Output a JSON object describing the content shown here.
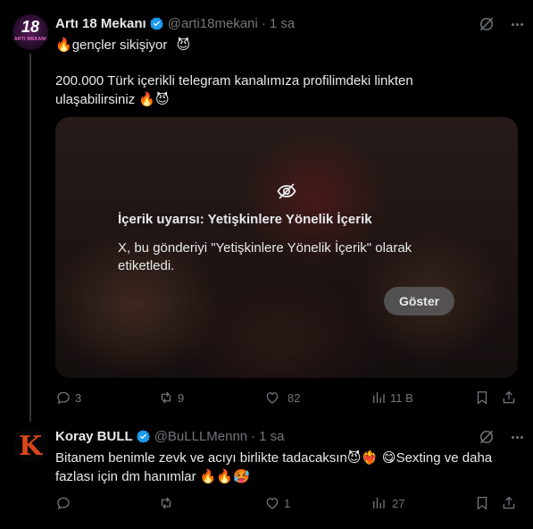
{
  "tweets": [
    {
      "name": "Artı 18 Mekanı",
      "handle": "@arti18mekani",
      "time": "1 sa",
      "avatar_text": "18",
      "avatar_subtext": "ARTI MEKANI",
      "line1_pre_emoji": "🔥",
      "line1_text": "gençler sikişiyor",
      "line1_post_emoji": "😈",
      "line2": "200.000 Türk içerikli telegram kanalımıza profilimdeki linkten",
      "line3_text": "ulaşabilirsiniz",
      "line3_emojis": "🔥😈",
      "media": {
        "warning_title": "İçerik uyarısı: Yetişkinlere Yönelik İçerik",
        "warning_body": "X, bu gönderiyi \"Yetişkinlere Yönelik İçerik\" olarak etiketledi.",
        "show_label": "Göster"
      },
      "stats": {
        "replies": "3",
        "reposts": "9",
        "likes": "82",
        "views": "11 B"
      }
    },
    {
      "name": "Koray BULL",
      "handle": "@BuLLLMennn",
      "time": "1 sa",
      "avatar_text": "K",
      "line1_text": "Bitanem benimle zevk ve acıyı birlikte tadacaksın",
      "line1_emojis": "😈❤️‍🔥 😋",
      "line1_tail": "Sexting ve daha",
      "line2_text": "fazlası için dm hanımlar",
      "line2_emojis": "🔥🔥🥵",
      "stats": {
        "replies": "",
        "reposts": "",
        "likes": "1",
        "views": "27"
      }
    }
  ],
  "colors": {
    "background": "#000000",
    "text": "#e7e9ea",
    "muted": "#71767b",
    "verified": "#1d9bf0",
    "divider": "#2f3336"
  }
}
